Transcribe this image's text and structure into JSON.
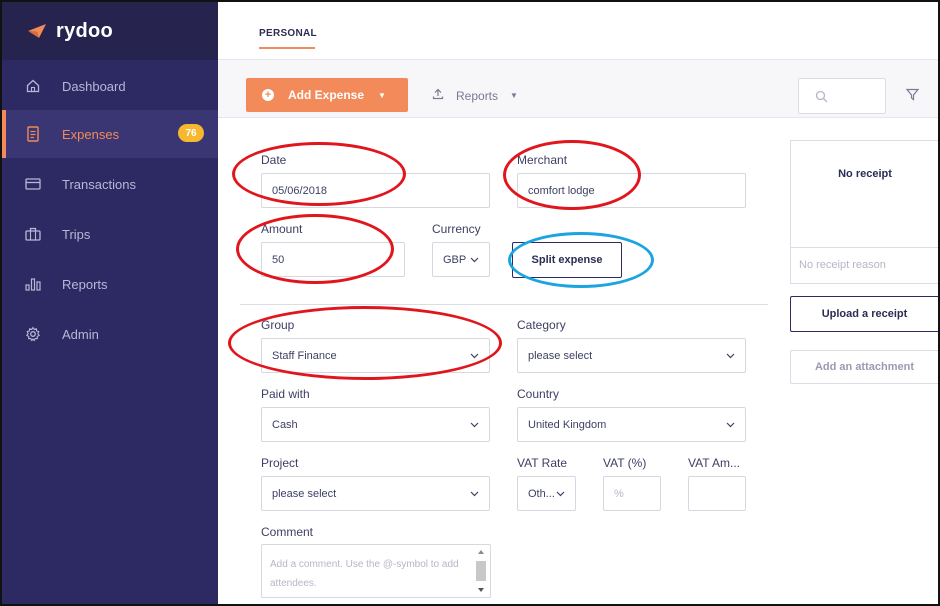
{
  "brand": {
    "name": "rydoo"
  },
  "sidebar": {
    "items": [
      {
        "label": "Dashboard",
        "icon": "home-icon"
      },
      {
        "label": "Expenses",
        "icon": "receipt-icon",
        "badge": "76",
        "active": true
      },
      {
        "label": "Transactions",
        "icon": "card-icon"
      },
      {
        "label": "Trips",
        "icon": "suitcase-icon"
      },
      {
        "label": "Reports",
        "icon": "bar-chart-icon"
      },
      {
        "label": "Admin",
        "icon": "gear-icon"
      }
    ]
  },
  "topbar": {
    "tab": "PERSONAL"
  },
  "toolbar": {
    "add_expense_label": "Add Expense",
    "reports_label": "Reports",
    "search_placeholder": "",
    "filter_icon": "filter-icon"
  },
  "form": {
    "date": {
      "label": "Date",
      "value": "05/06/2018"
    },
    "merchant": {
      "label": "Merchant",
      "value": "comfort lodge"
    },
    "amount": {
      "label": "Amount",
      "value": "50"
    },
    "currency": {
      "label": "Currency",
      "value": "GBP"
    },
    "split_label": "Split expense",
    "group": {
      "label": "Group",
      "value": "Staff Finance"
    },
    "category": {
      "label": "Category",
      "value": "please select"
    },
    "paid_with": {
      "label": "Paid with",
      "value": "Cash"
    },
    "country": {
      "label": "Country",
      "value": "United Kingdom"
    },
    "project": {
      "label": "Project",
      "value": "please select"
    },
    "vat_rate": {
      "label": "VAT Rate",
      "value": "Oth..."
    },
    "vat_percent": {
      "label": "VAT (%)",
      "placeholder": "%"
    },
    "vat_amount": {
      "label": "VAT Am...",
      "value": ""
    },
    "comment": {
      "label": "Comment",
      "placeholder": "Add a comment. Use the @-symbol to add attendees."
    }
  },
  "receipt": {
    "title": "No receipt",
    "reason_placeholder": "No receipt reason",
    "upload_label": "Upload a receipt",
    "attach_label": "Add an attachment"
  },
  "colors": {
    "sidebar_bg": "#2d2a63",
    "accent": "#f28a5a",
    "badge": "#f5b82e",
    "annotation_red": "#e0161c",
    "annotation_blue": "#1aa4e0"
  }
}
